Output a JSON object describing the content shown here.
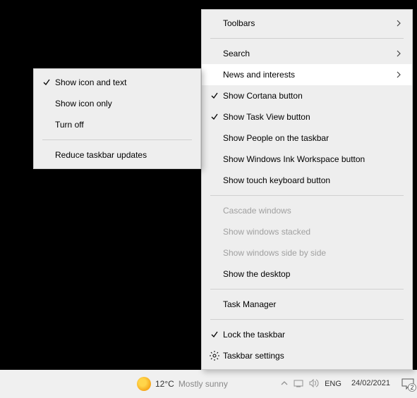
{
  "taskbar": {
    "weather_temp": "12°C",
    "weather_text": "Mostly sunny",
    "lang": "ENG",
    "date": "24/02/2021",
    "notif_count": "2"
  },
  "main_menu": {
    "toolbars": "Toolbars",
    "search": "Search",
    "news": "News and interests",
    "cortana": "Show Cortana button",
    "taskview": "Show Task View button",
    "people": "Show People on the taskbar",
    "ink": "Show Windows Ink Workspace button",
    "touchkb": "Show touch keyboard button",
    "cascade": "Cascade windows",
    "stacked": "Show windows stacked",
    "sidebyside": "Show windows side by side",
    "desktop": "Show the desktop",
    "taskmgr": "Task Manager",
    "lock": "Lock the taskbar",
    "settings": "Taskbar settings"
  },
  "sub_menu": {
    "icon_text": "Show icon and text",
    "icon_only": "Show icon only",
    "turn_off": "Turn off",
    "reduce": "Reduce taskbar updates"
  }
}
